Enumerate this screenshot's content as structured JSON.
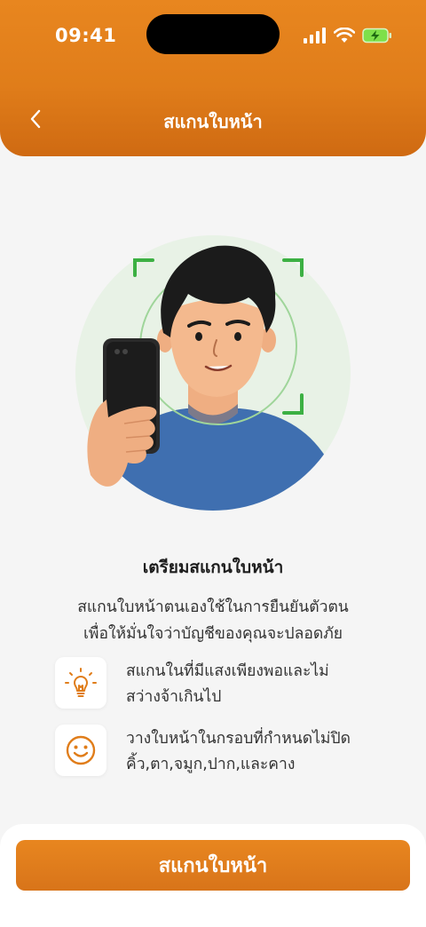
{
  "status_bar": {
    "time": "09:41"
  },
  "header": {
    "title": "สแกนใบหน้า"
  },
  "content": {
    "title": "เตรียมสแกนใบหน้า",
    "description_line1": "สแกนใบหน้าตนเองใช้ในการยืนยันตัวตน",
    "description_line2": "เพื่อให้มั่นใจว่าบัญชีของคุณจะปลอดภัย",
    "tips": [
      {
        "icon": "lightbulb-icon",
        "line1": "สแกนในที่มีแสงเพียงพอและไม่",
        "line2": "สว่างจ้าเกินไป"
      },
      {
        "icon": "smiley-face-icon",
        "line1": "วางใบหน้าในกรอบที่กำหนดไม่ปิด",
        "line2": "คิ้ว,ตา,จมูก,ปาก,และคาง"
      }
    ]
  },
  "action": {
    "scan_button_label": "สแกนใบหน้า"
  },
  "colors": {
    "primary": "#e07d1a",
    "scan_frame": "#3cb043",
    "shirt": "#3f6fb0"
  }
}
